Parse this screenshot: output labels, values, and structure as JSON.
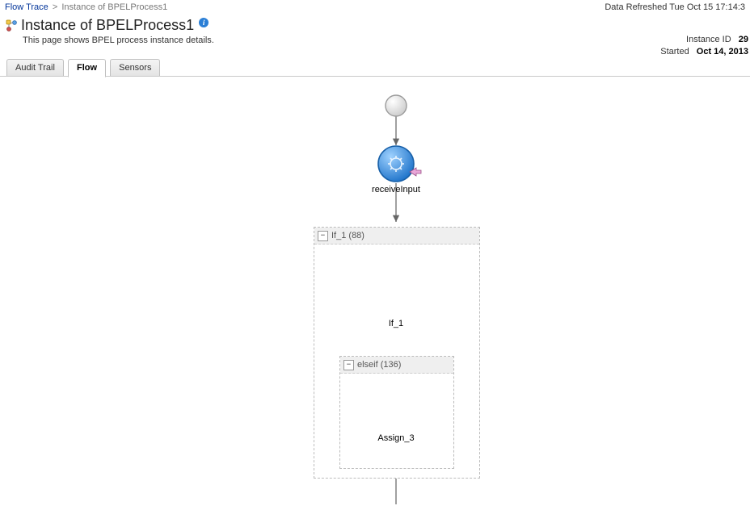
{
  "breadcrumb": {
    "root_label": "Flow Trace",
    "current_label": "Instance of BPELProcess1"
  },
  "header": {
    "refresh_text": "Data Refreshed Tue Oct 15 17:14:3",
    "title": "Instance of BPELProcess1",
    "subtitle": "This page shows BPEL process instance details.",
    "instance_id_label": "Instance ID",
    "instance_id_value": "29",
    "started_label": "Started",
    "started_value": "Oct 14, 2013"
  },
  "tabs": {
    "audit_trail": "Audit Trail",
    "flow": "Flow",
    "sensors": "Sensors"
  },
  "flow": {
    "receive_label": "receiveInput",
    "if_box_title": "If_1 (88)",
    "if_label": "If_1",
    "elseif_box_title": "elseif (136)",
    "assign_label": "Assign_3",
    "collapse_glyph": "−"
  }
}
